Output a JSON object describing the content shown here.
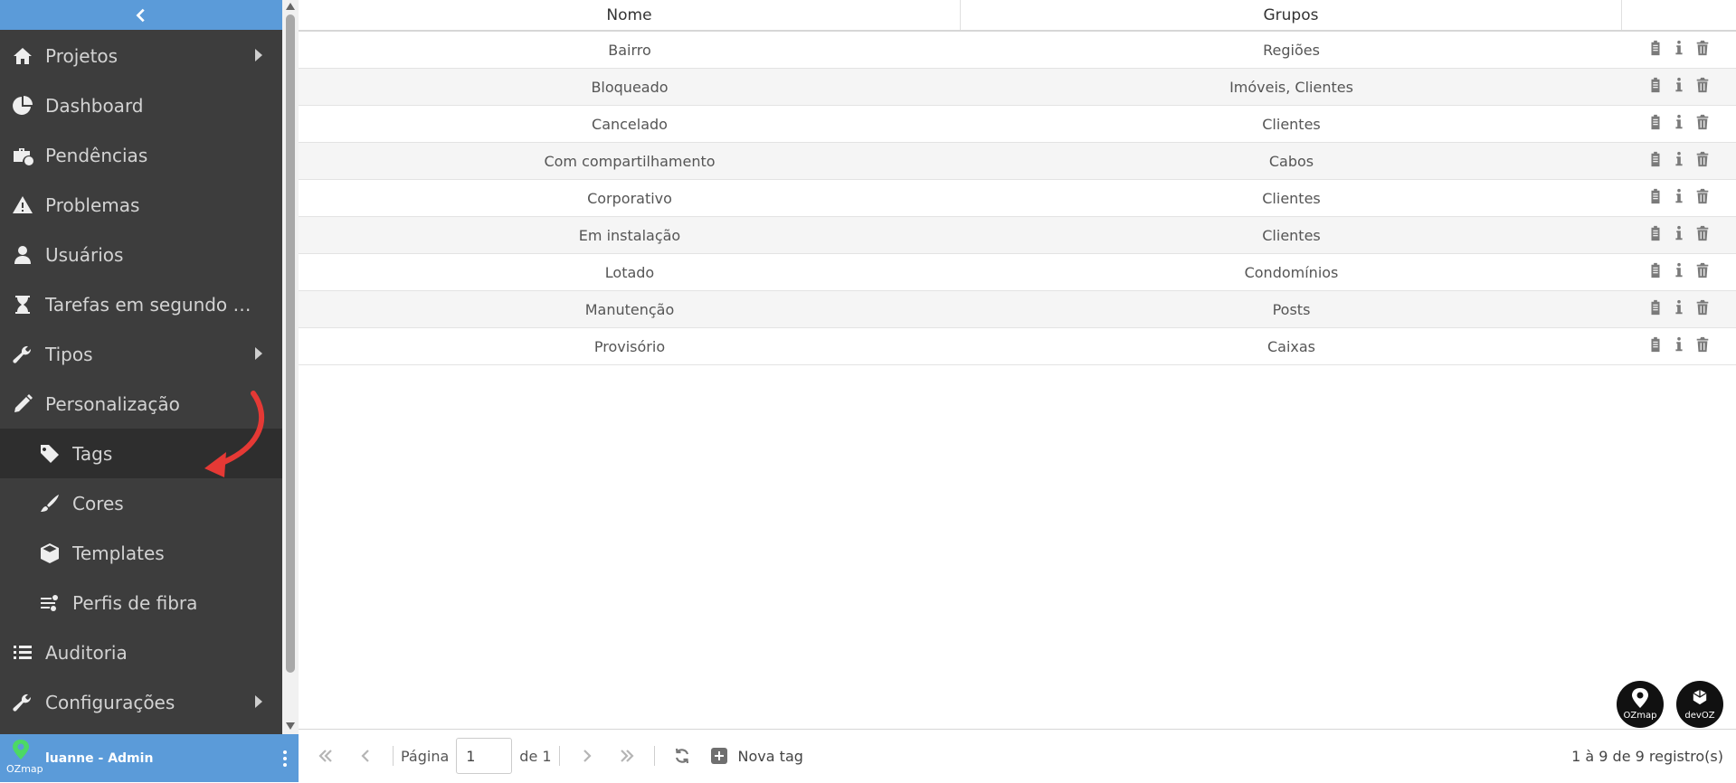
{
  "sidebar": {
    "menu": [
      {
        "label": "Projetos",
        "icon": "home-icon",
        "has_submenu": true
      },
      {
        "label": "Dashboard",
        "icon": "pie-chart-icon"
      },
      {
        "label": "Pendências",
        "icon": "briefcase-clock-icon"
      },
      {
        "label": "Problemas",
        "icon": "warning-icon"
      },
      {
        "label": "Usuários",
        "icon": "user-icon"
      },
      {
        "label": "Tarefas em segundo plano",
        "icon": "hourglass-icon"
      },
      {
        "label": "Tipos",
        "icon": "wrench-icon",
        "has_submenu": true
      },
      {
        "label": "Personalização",
        "icon": "pencil-icon",
        "expanded": true
      },
      {
        "label": "Tags",
        "icon": "tag-icon",
        "sub": true,
        "active": true
      },
      {
        "label": "Cores",
        "icon": "brush-icon",
        "sub": true
      },
      {
        "label": "Templates",
        "icon": "cube-icon",
        "sub": true
      },
      {
        "label": "Perfis de fibra",
        "icon": "fiber-icon",
        "sub": true
      },
      {
        "label": "Auditoria",
        "icon": "list-icon"
      },
      {
        "label": "Configurações",
        "icon": "wrench-icon",
        "has_submenu": true
      }
    ],
    "user": {
      "name": "luanne - Admin",
      "logo_text": "OZmap"
    }
  },
  "table": {
    "headers": {
      "nome": "Nome",
      "grupos": "Grupos"
    },
    "rows": [
      {
        "nome": "Bairro",
        "grupos": "Regiões"
      },
      {
        "nome": "Bloqueado",
        "grupos": "Imóveis, Clientes"
      },
      {
        "nome": "Cancelado",
        "grupos": "Clientes"
      },
      {
        "nome": "Com compartilhamento",
        "grupos": "Cabos"
      },
      {
        "nome": "Corporativo",
        "grupos": "Clientes"
      },
      {
        "nome": "Em instalação",
        "grupos": "Clientes"
      },
      {
        "nome": "Lotado",
        "grupos": "Condomínios"
      },
      {
        "nome": "Manutenção",
        "grupos": "Posts"
      },
      {
        "nome": "Provisório",
        "grupos": "Caixas"
      }
    ]
  },
  "badges": {
    "ozmap": "OZmap",
    "devoz": "devOZ"
  },
  "pager": {
    "page_label": "Página",
    "page_value": "1",
    "of_label": "de 1",
    "new_tag_label": "Nova tag",
    "records_text": "1 à 9 de 9 registro(s)"
  },
  "colors": {
    "accent": "#5b9bd9",
    "sidebar": "#3d3d3d"
  }
}
